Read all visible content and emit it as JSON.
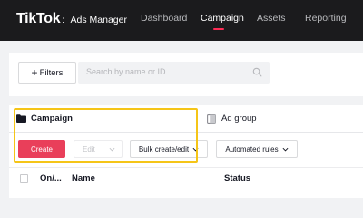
{
  "brand": {
    "logo": "TikTok",
    "separator": ":",
    "product": "Ads Manager"
  },
  "nav": {
    "items": [
      "Dashboard",
      "Campaign",
      "Assets",
      "Reporting"
    ],
    "active": "Campaign"
  },
  "filters": {
    "button_label": "Filters",
    "search_placeholder": "Search by name or ID"
  },
  "tabs": {
    "campaign": "Campaign",
    "ad_group": "Ad group"
  },
  "toolbar": {
    "create": "Create",
    "edit": "Edit",
    "bulk": "Bulk create/edit",
    "rules": "Automated rules"
  },
  "table": {
    "columns": [
      "On/...",
      "Name",
      "Status"
    ]
  },
  "colors": {
    "accent": "#fe2c55",
    "create_button": "#e93f5a",
    "highlight": "#f5c518",
    "topbar": "#1b1b1d"
  }
}
